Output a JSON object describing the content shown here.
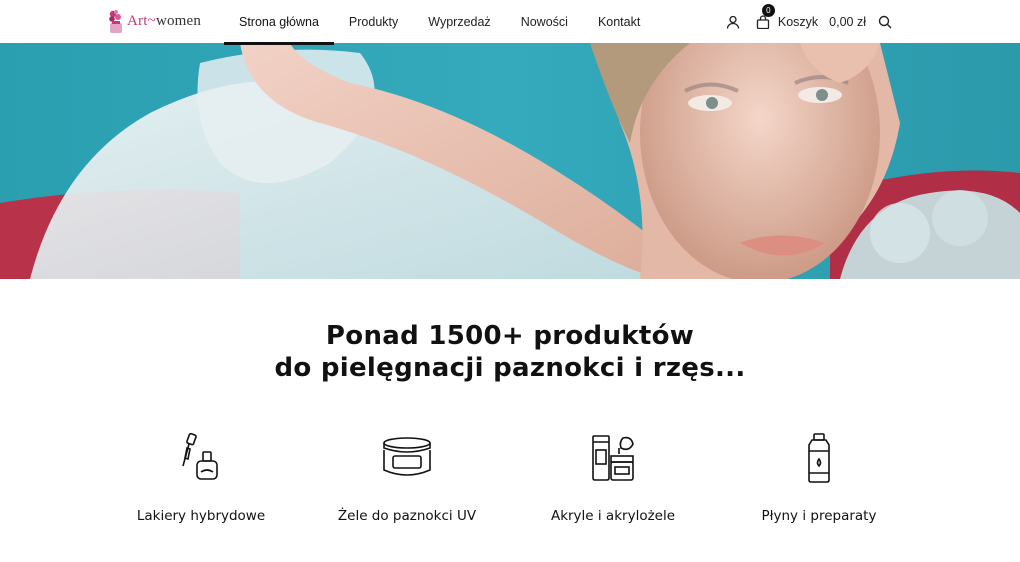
{
  "header": {
    "logo": {
      "art": "Art",
      "dash": "~",
      "women": "women"
    },
    "nav": [
      {
        "label": "Strona główna",
        "active": true
      },
      {
        "label": "Produkty"
      },
      {
        "label": "Wyprzedaż"
      },
      {
        "label": "Nowości"
      },
      {
        "label": "Kontakt"
      }
    ],
    "cart": {
      "count": "0",
      "label": "Koszyk",
      "total": "0,00 zł"
    }
  },
  "hero": {
    "icon": "hero-photo-woman-makeup"
  },
  "headline": {
    "line1": "Ponad 1500+ produktów",
    "line2": "do pielęgnacji paznokci i rzęs..."
  },
  "categories": [
    {
      "label": "Lakiery hybrydowe",
      "icon": "nail-polish-icon"
    },
    {
      "label": "Żele do paznokci UV",
      "icon": "gel-jar-icon"
    },
    {
      "label": "Akryle i akrylożele",
      "icon": "acrylic-products-icon"
    },
    {
      "label": "Płyny i preparaty",
      "icon": "liquid-bottle-icon"
    }
  ],
  "colors": {
    "brand": "#c23a79",
    "hero_bg": "#2da2b2",
    "text": "#111111"
  }
}
